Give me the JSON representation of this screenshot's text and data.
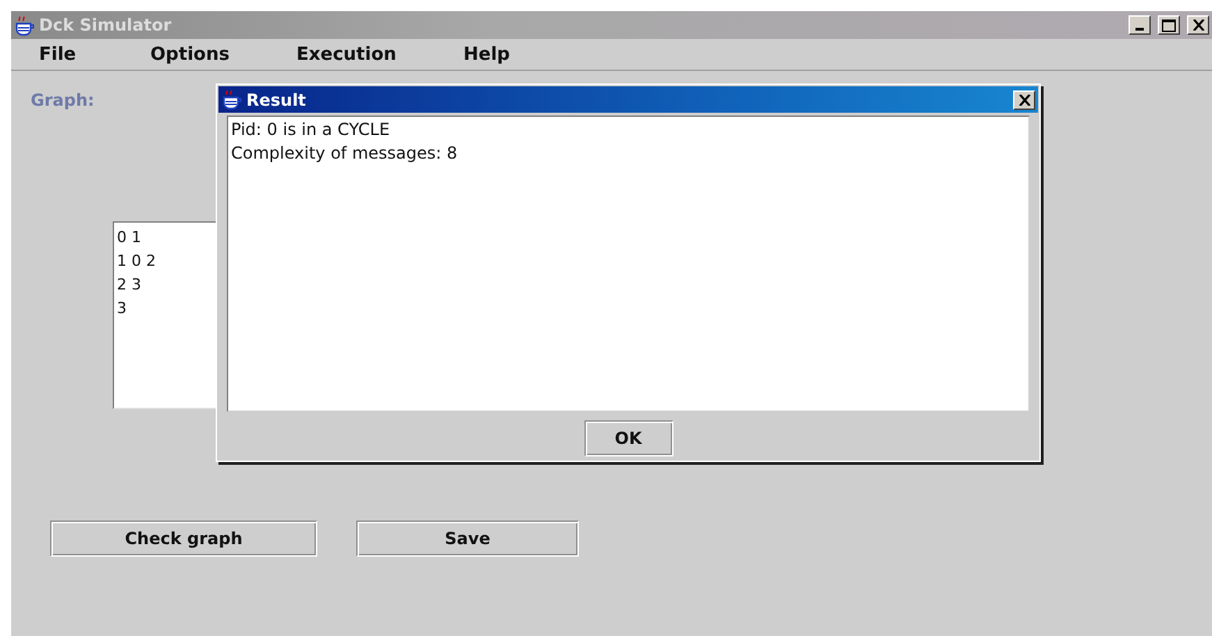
{
  "window": {
    "title": "Dck Simulator"
  },
  "menu": [
    "File",
    "Options",
    "Execution",
    "Help"
  ],
  "graph": {
    "label": "Graph:",
    "lines": [
      "0 1",
      "1 0 2",
      "2 3",
      "3"
    ]
  },
  "buttons": [
    "Check graph",
    "Save"
  ],
  "dialog": {
    "title": "Result",
    "lines": [
      "Pid: 0 is in a CYCLE",
      "Complexity of messages: 8"
    ],
    "button": "OK"
  }
}
